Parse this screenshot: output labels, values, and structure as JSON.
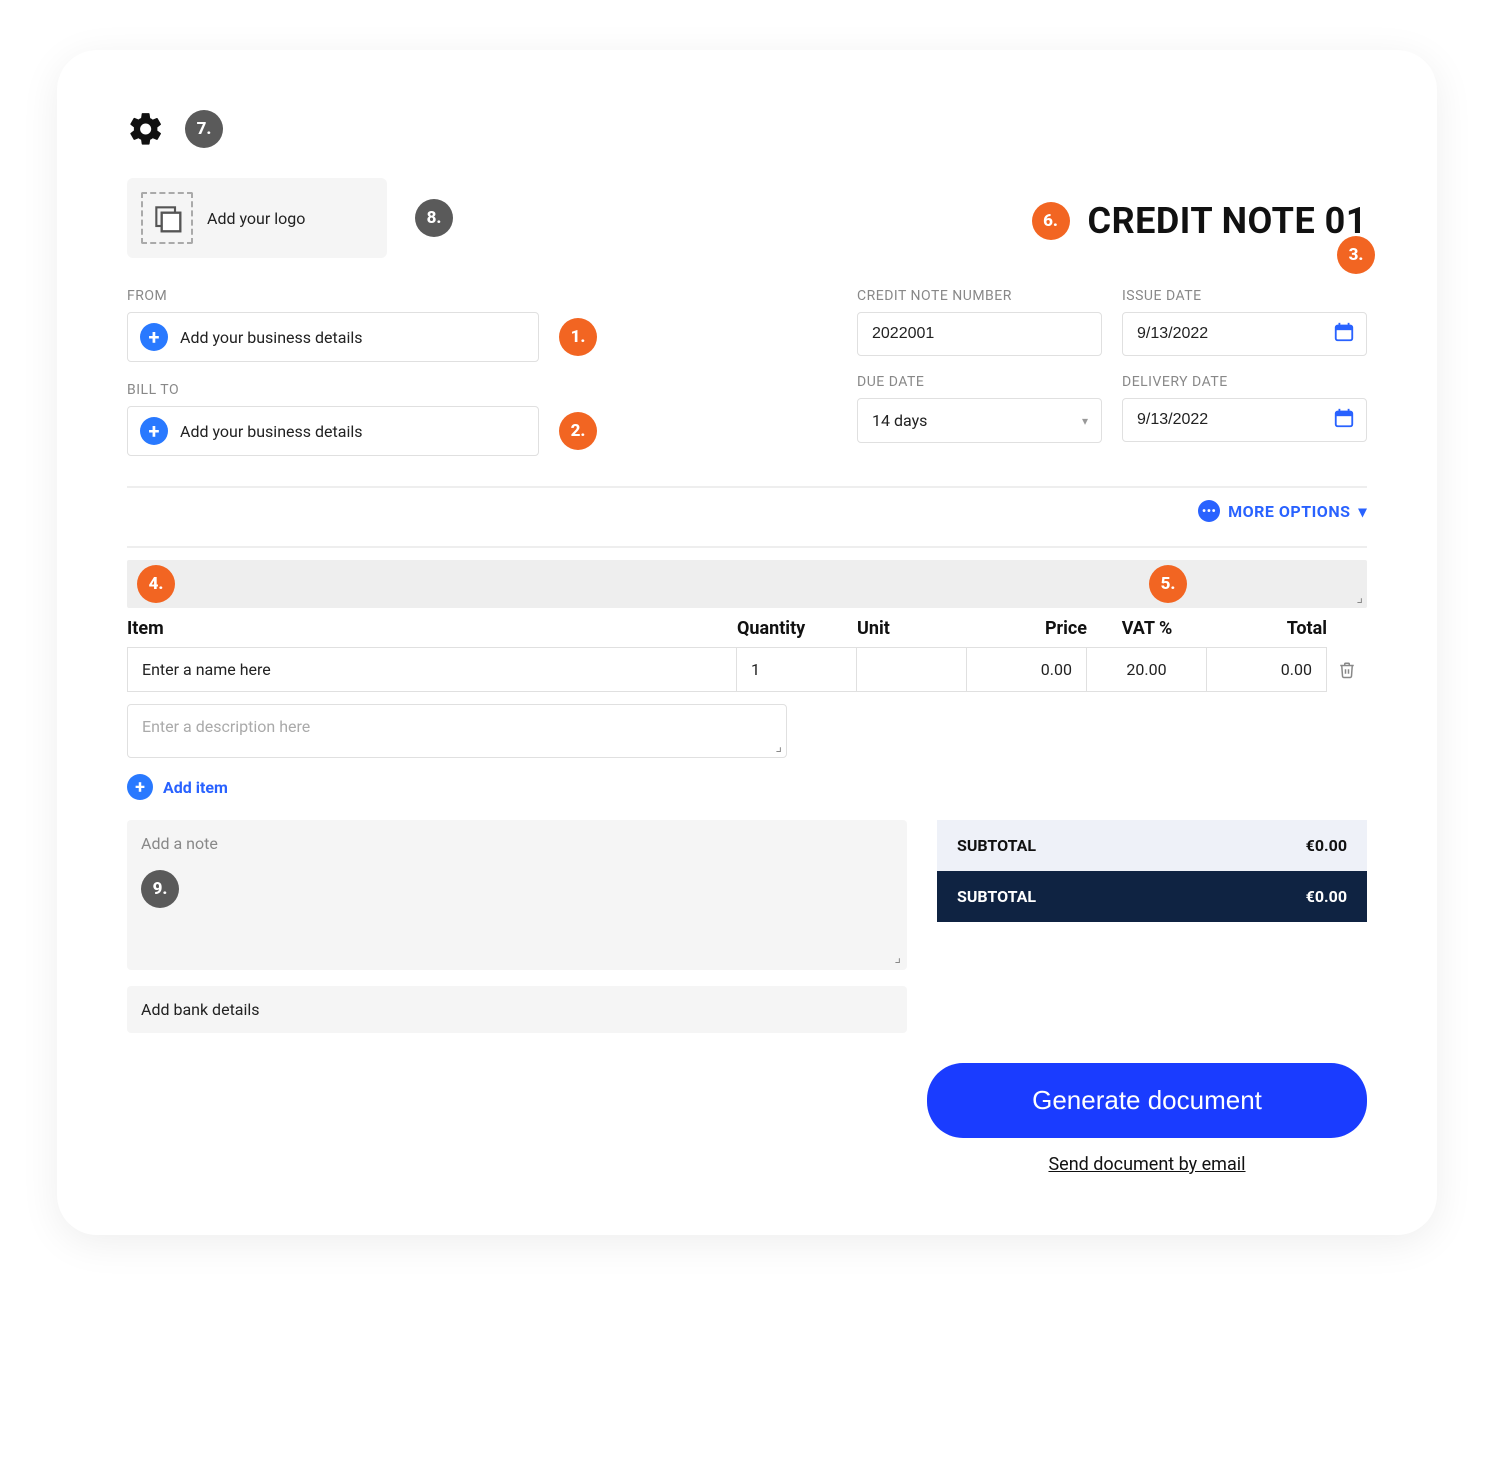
{
  "annotations": {
    "b1": "1.",
    "b2": "2.",
    "b3": "3.",
    "b4": "4.",
    "b5": "5.",
    "b6": "6.",
    "b7": "7.",
    "b8": "8.",
    "b9": "9."
  },
  "logo": {
    "label": "Add your logo"
  },
  "doc_title": "CREDIT NOTE 01",
  "from": {
    "label": "FROM",
    "placeholder": "Add your business details"
  },
  "billto": {
    "label": "BILL TO",
    "placeholder": "Add your business details"
  },
  "meta": {
    "number": {
      "label": "CREDIT NOTE NUMBER",
      "value": "2022001"
    },
    "issue": {
      "label": "ISSUE DATE",
      "value": "9/13/2022"
    },
    "due": {
      "label": "DUE DATE",
      "value": "14 days"
    },
    "delivery": {
      "label": "DELIVERY DATE",
      "value": "9/13/2022"
    }
  },
  "more_options": "MORE OPTIONS",
  "items": {
    "headers": {
      "item": "Item",
      "qty": "Quantity",
      "unit": "Unit",
      "price": "Price",
      "vat": "VAT %",
      "total": "Total"
    },
    "row": {
      "name_placeholder": "Enter a name here",
      "qty": "1",
      "unit": "",
      "price": "0.00",
      "vat": "20.00",
      "total": "0.00",
      "desc_placeholder": "Enter a description here"
    },
    "add_label": "Add item"
  },
  "note_placeholder": "Add a note",
  "totals": {
    "subtotal_label": "SUBTOTAL",
    "subtotal_value": "€0.00",
    "grand_label": "SUBTOTAL",
    "grand_value": "€0.00"
  },
  "bank_label": "Add bank details",
  "actions": {
    "generate": "Generate document",
    "send": "Send document by email"
  }
}
